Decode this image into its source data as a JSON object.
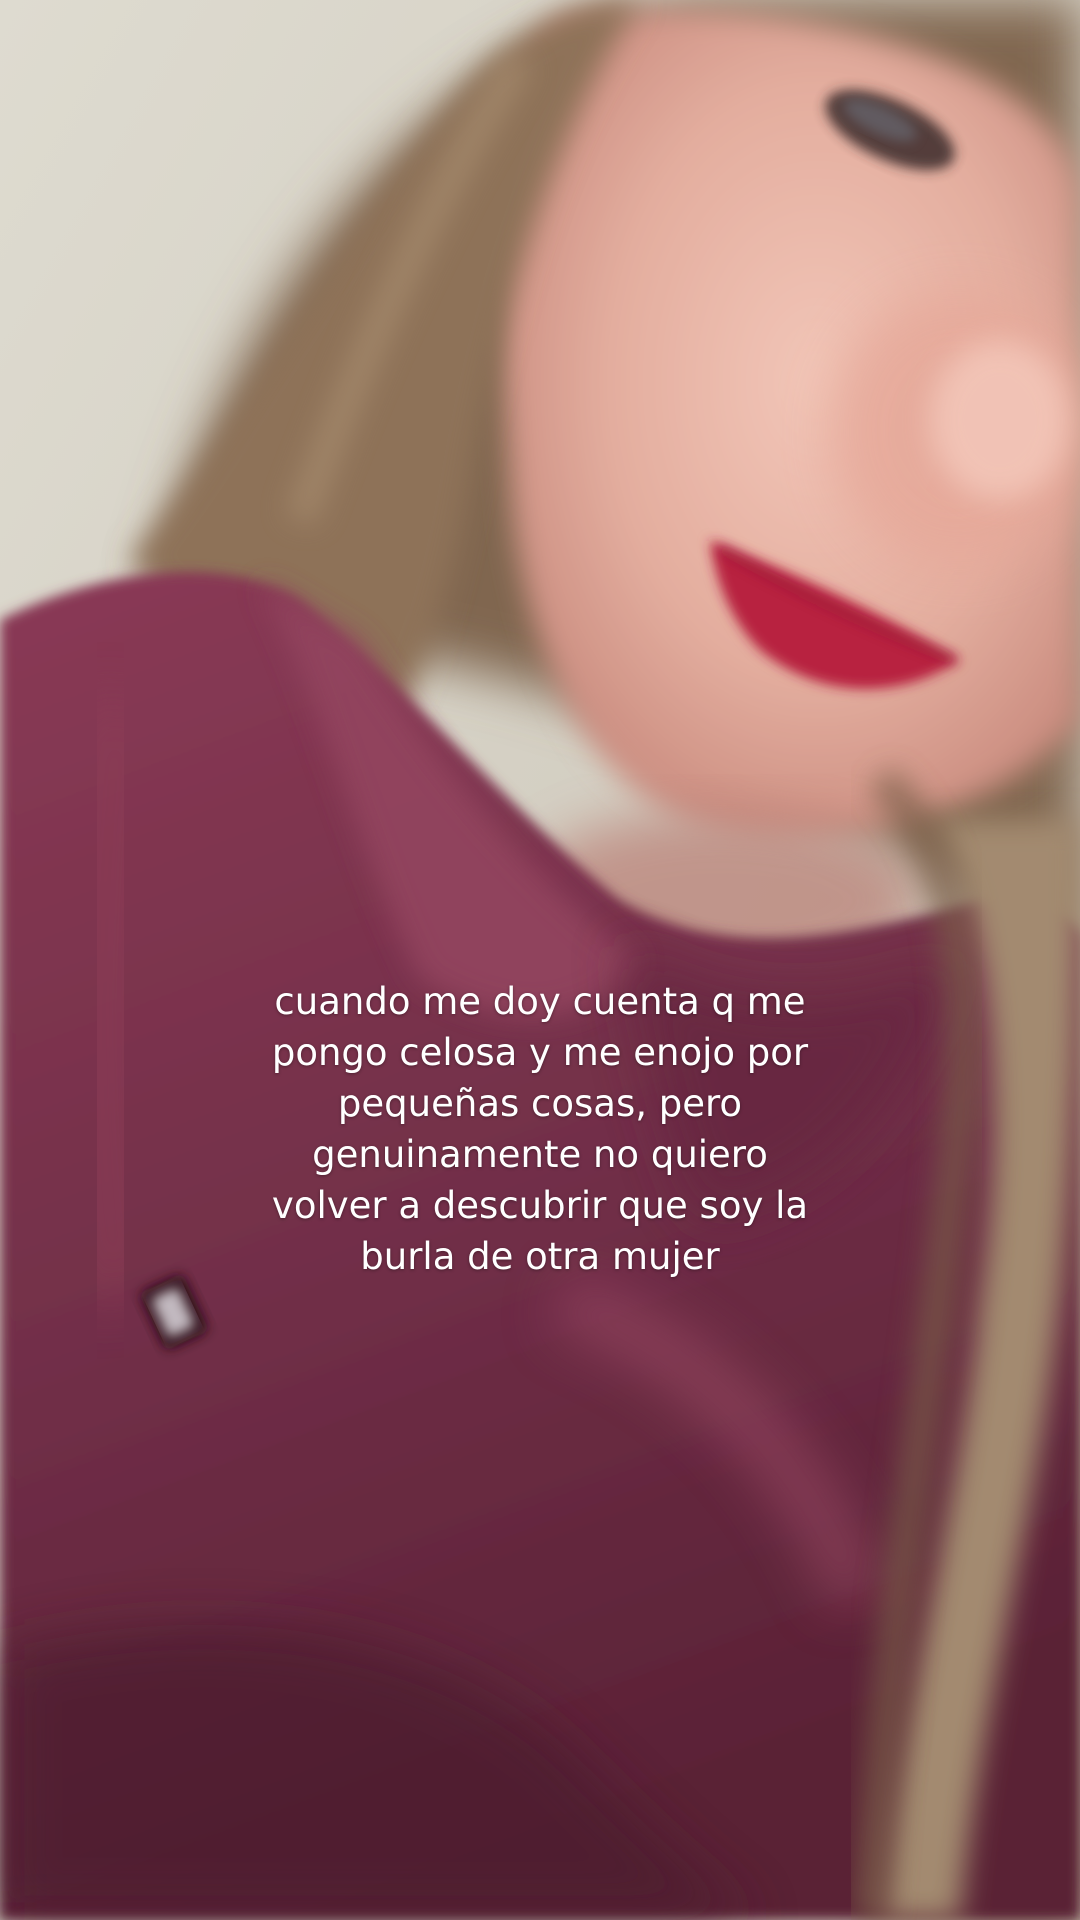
{
  "caption": {
    "lines": [
      "cuando me doy cuenta q me",
      "pongo celosa y me enojo por",
      "pequeñas cosas, pero",
      "genuinamente no quiero",
      "volver a descubrir que soy la",
      "burla de otra mujer"
    ]
  },
  "colors": {
    "wall": "#d8d3c6",
    "hoodie": "#7a3048",
    "hair": "#8d725a",
    "skin": "#e8b6a8",
    "lips": "#b8243f",
    "caption_text": "#ffffff"
  }
}
